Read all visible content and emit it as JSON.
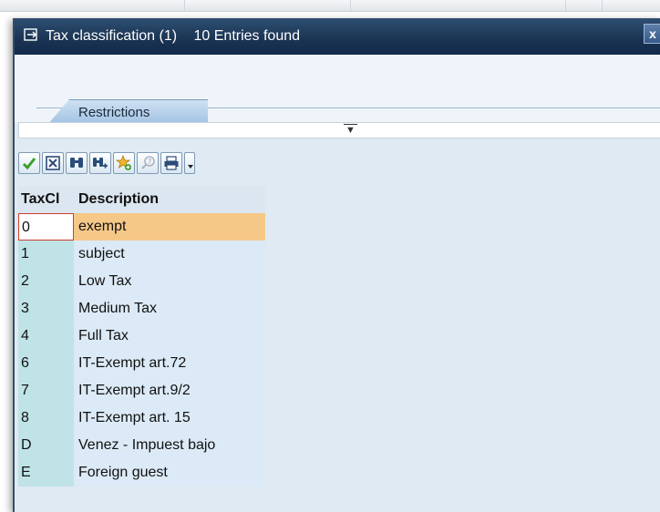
{
  "dialog": {
    "title": "Tax classification (1)",
    "entries_found": "10 Entries found",
    "close_label": "x",
    "colors": {
      "title_bar": "#1b3554",
      "selected_row": "#f6c888",
      "key_column": "#bfe3e6"
    }
  },
  "tabs": [
    {
      "label": "Restrictions"
    }
  ],
  "toolbar": {
    "icons": [
      "checkmark-icon",
      "cancel-icon",
      "find-icon",
      "find-next-icon",
      "favorite-add-icon",
      "help-icon",
      "print-icon",
      "dropdown-icon"
    ]
  },
  "table": {
    "columns": [
      "TaxCl",
      "Description"
    ],
    "selected_index": 0,
    "rows": [
      {
        "code": "0",
        "description": "exempt"
      },
      {
        "code": "1",
        "description": "subject"
      },
      {
        "code": "2",
        "description": "Low Tax"
      },
      {
        "code": "3",
        "description": "Medium Tax"
      },
      {
        "code": "4",
        "description": "Full Tax"
      },
      {
        "code": "6",
        "description": "IT-Exempt art.72"
      },
      {
        "code": "7",
        "description": "IT-Exempt art.9/2"
      },
      {
        "code": "8",
        "description": "IT-Exempt art. 15"
      },
      {
        "code": "D",
        "description": "Venez - Impuest bajo"
      },
      {
        "code": "E",
        "description": "Foreign guest"
      }
    ]
  }
}
